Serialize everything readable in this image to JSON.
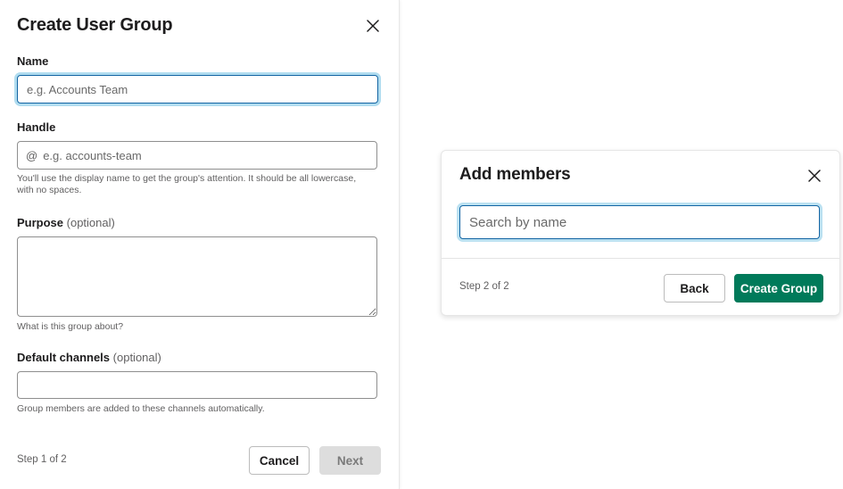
{
  "create_group": {
    "title": "Create User Group",
    "name": {
      "label": "Name",
      "placeholder": "e.g. Accounts Team"
    },
    "handle": {
      "label": "Handle",
      "prefix": "@",
      "placeholder": "e.g. accounts-team",
      "hint_line1": "You'll use the display name to get the group's attention. It should be all lowercase,",
      "hint_line2": "with no spaces."
    },
    "purpose": {
      "label": "Purpose",
      "optional": "(optional)",
      "hint": "What is this group about?"
    },
    "default_channels": {
      "label": "Default channels",
      "optional": "(optional)",
      "hint": "Group members are added to these channels automatically."
    },
    "step": "Step 1 of 2",
    "cancel_label": "Cancel",
    "next_label": "Next"
  },
  "add_members": {
    "title": "Add members",
    "search_placeholder": "Search by name",
    "step": "Step 2 of 2",
    "back_label": "Back",
    "create_label": "Create Group"
  },
  "icons": {
    "close_left": "close-icon",
    "close_right": "close-icon"
  },
  "colors": {
    "primary_green": "#007a5a",
    "focus_blue": "#1264a3",
    "disabled_bg": "#dddddd"
  }
}
